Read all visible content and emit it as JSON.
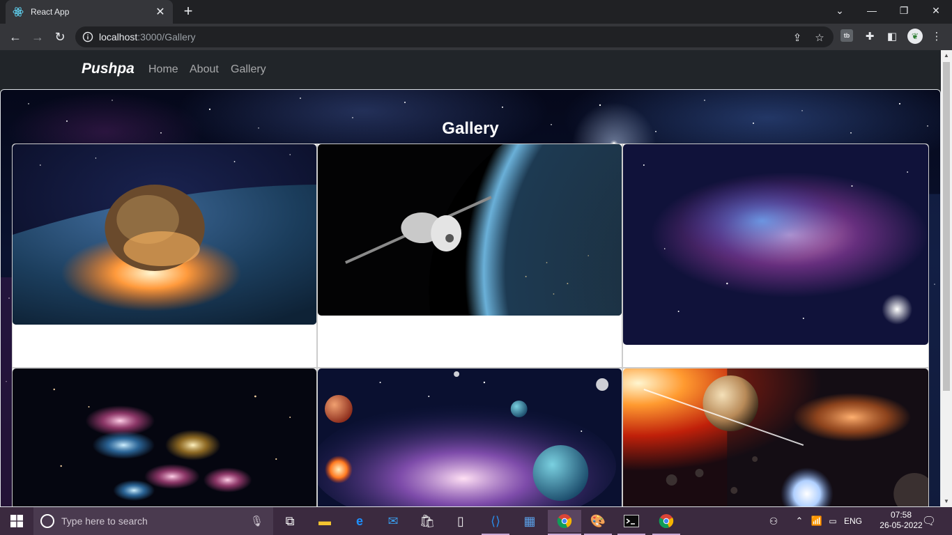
{
  "browser": {
    "tab_title": "React App",
    "tab_close": "✕",
    "new_tab": "+",
    "url_host": "localhost",
    "url_path": ":3000/Gallery",
    "icons": [
      "react-logo-icon",
      "back-icon",
      "forward-icon",
      "reload-icon",
      "info-icon",
      "share-icon",
      "star-icon",
      "extension-icon",
      "puzzle-icon",
      "sidebar-icon",
      "profile-icon",
      "menu-icon"
    ]
  },
  "nav": {
    "brand": "Pushpa",
    "links": [
      "Home",
      "About",
      "Gallery"
    ]
  },
  "main": {
    "title": "Gallery",
    "cards": [
      {
        "subject": "asteroid hitting earth"
      },
      {
        "subject": "satellite over earth"
      },
      {
        "subject": "nebula starfield"
      },
      {
        "subject": "galaxies"
      },
      {
        "subject": "planets nebula"
      },
      {
        "subject": "solar system planets"
      }
    ]
  },
  "taskbar": {
    "search_placeholder": "Type here to search",
    "language": "ENG",
    "time": "07:58",
    "date": "26-05-2022"
  },
  "colors": {
    "navbar_bg": "#212529",
    "nav_link": "rgba(255,255,255,0.6)",
    "taskbar_bg": "#3b2a3f",
    "chrome_bg": "#35363a"
  }
}
